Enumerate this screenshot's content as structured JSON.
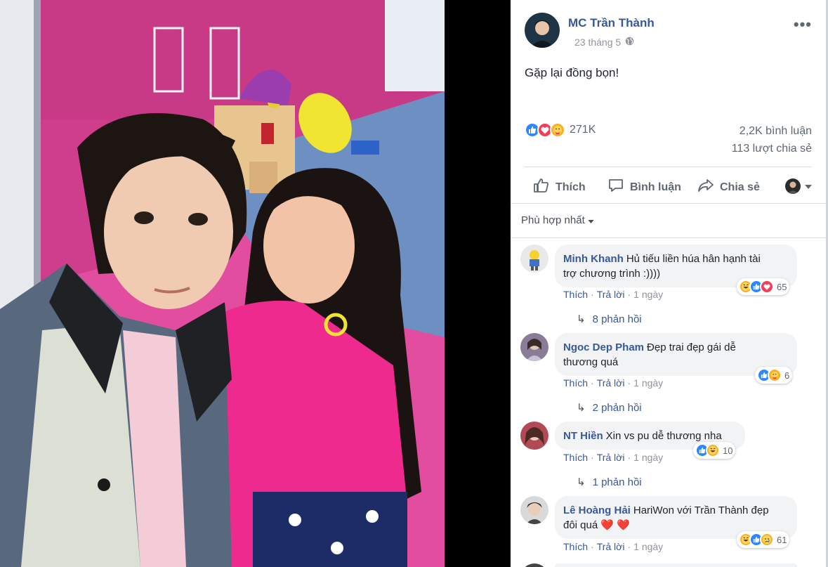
{
  "post": {
    "author": "MC Trần Thành",
    "date": "23 tháng 5",
    "privacy_icon": "globe-icon",
    "text": "Gặp lại đồng bọn!",
    "reaction_count": "271K",
    "comment_count": "2,2K bình luận",
    "share_count": "113 lượt chia sẻ"
  },
  "actions": {
    "like": "Thích",
    "comment": "Bình luận",
    "share": "Chia sẻ"
  },
  "filter": {
    "label": "Phù hợp nhất"
  },
  "comments": [
    {
      "name": "Minh Khanh",
      "line1": "Hủ tiếu liền húa hân hạnh tài",
      "line2": "trợ chương trình :))))",
      "like": "Thích",
      "reply": "Trả lời",
      "time": "1 ngày",
      "reaction_count": "65",
      "replies": "8 phản hồi"
    },
    {
      "name": "Ngoc Dep Pham",
      "line1": "Đẹp trai đẹp gái dễ",
      "line2": "thương quá",
      "like": "Thích",
      "reply": "Trả lời",
      "time": "1 ngày",
      "reaction_count": "6",
      "replies": "2 phản hồi"
    },
    {
      "name": "NT Hiền",
      "line1": "Xin vs pu dễ thương nha",
      "like": "Thích",
      "reply": "Trả lời",
      "time": "1 ngày",
      "reaction_count": "10",
      "replies": "1 phản hồi"
    },
    {
      "name": "Lê Hoàng Hải",
      "line1": "HariWon với Trần Thành đẹp",
      "line2": "đôi quá",
      "line2_emoji": "❤️ ❤️",
      "like": "Thích",
      "reply": "Trả lời",
      "time": "1 ngày",
      "reaction_count": "61"
    }
  ],
  "colors": {
    "link": "#385898",
    "like_blue": "#2d88ff",
    "love_red": "#f33e58",
    "haha_yellow": "#f7b125",
    "bubble_bg": "#f2f3f5"
  }
}
